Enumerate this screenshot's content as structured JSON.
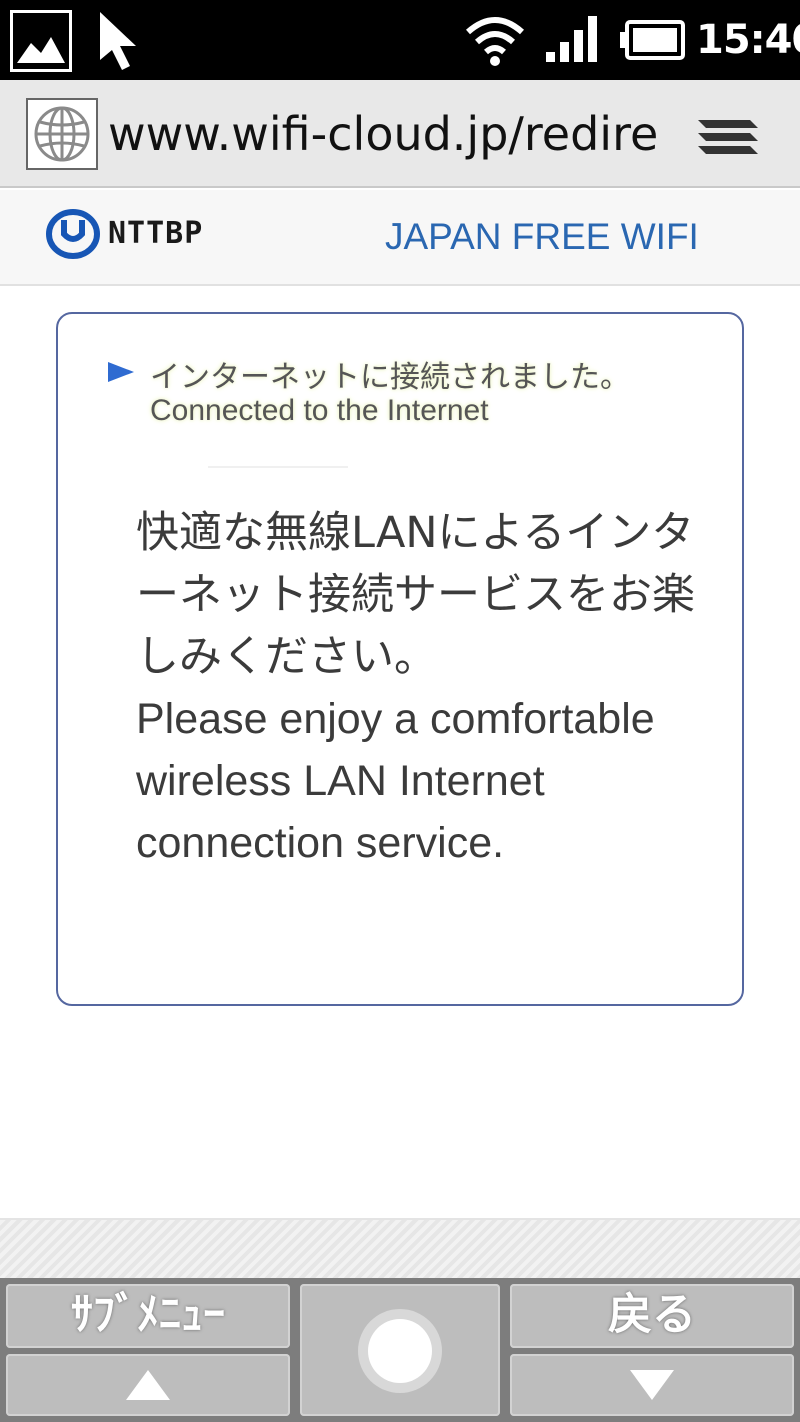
{
  "status_bar": {
    "time": "15:40",
    "icons": [
      "gallery-icon",
      "cursor-icon",
      "wifi-icon",
      "signal-icon",
      "battery-icon"
    ]
  },
  "browser": {
    "url": "www.wifi-cloud.jp/redire",
    "icons": [
      "globe-icon",
      "tabs-menu-icon"
    ]
  },
  "site_header": {
    "logo_text": "NTTBP",
    "service_name": "JAPAN FREE WIFI"
  },
  "notice": {
    "connected_ja": "インターネットに接続されました。",
    "connected_en": "Connected to the Internet",
    "message_ja": "快適な無線LANによるインターネット接続サービスをお楽しみください。",
    "message_en": "Please enjoy a comfortable wireless LAN Internet connection service."
  },
  "softkeys": {
    "left_label": "ｻﾌﾞﾒﾆｭｰ",
    "right_label": "戻る",
    "icons": [
      "up-arrow-icon",
      "center-select-icon",
      "down-arrow-icon"
    ]
  },
  "colors": {
    "accent_blue": "#2a67b1",
    "box_border": "#5567a0",
    "text_dark": "#3b3b3b",
    "softkey_gray": "#bdbdbd"
  }
}
